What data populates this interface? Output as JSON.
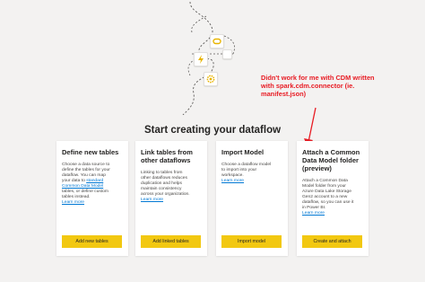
{
  "page": {
    "title": "Start creating your dataflow"
  },
  "annotation": {
    "lines": [
      "Didn't work for me with CDM written",
      "with spark.cdm.connector (ie.",
      "manifest.json)"
    ],
    "color": "#e81c24"
  },
  "colors": {
    "accent": "#f2c811",
    "link": "#0078d4"
  },
  "cards": [
    {
      "title_lines": [
        "Define new tables"
      ],
      "desc_lines": [
        "Choose a data source to",
        "define the tables for your",
        "dataflow. You can map",
        "your data to "
      ],
      "desc_link_lines": [
        "standard",
        "Common Data Model"
      ],
      "desc_tail_lines": [
        " tables, or define custom",
        "tables instead."
      ],
      "learn_more": "Learn more",
      "button": "Add new tables"
    },
    {
      "title_lines": [
        "Link tables from",
        "other dataflows"
      ],
      "desc_lines": [
        "Linking to tables from",
        "other dataflows reduces",
        "duplication and helps",
        "maintain consistency",
        "across your organization."
      ],
      "learn_more": "Learn more",
      "button": "Add linked tables"
    },
    {
      "title_lines": [
        "Import Model"
      ],
      "desc_lines": [
        "Choose a dataflow model",
        "to import into your",
        "workspace."
      ],
      "learn_more": "Learn more",
      "button": "Import model"
    },
    {
      "title_lines": [
        "Attach a Common",
        "Data Model folder",
        "(preview)"
      ],
      "desc_lines": [
        "Attach a Common Data",
        "Model folder from your",
        "Azure Data Lake Storage",
        "Gen2 account to a new",
        "dataflow, so you can use it",
        "in Power BI."
      ],
      "learn_more": "Learn more",
      "button": "Create and attach"
    }
  ],
  "icons": [
    "connector-icon",
    "lightning-icon",
    "gear-icon"
  ]
}
